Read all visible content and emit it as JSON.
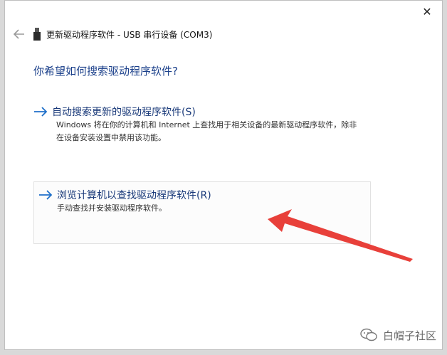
{
  "dialog": {
    "title": "更新驱动程序软件 - USB 串行设备 (COM3)",
    "close_glyph": "✕",
    "question": "你希望如何搜索驱动程序软件?",
    "options": [
      {
        "title": "自动搜索更新的驱动程序软件(S)",
        "description": "Windows 将在你的计算机和 Internet 上查找用于相关设备的最新驱动程序软件，除非在设备安装设置中禁用该功能。"
      },
      {
        "title": "浏览计算机以查找驱动程序软件(R)",
        "description": "手动查找并安装驱动程序软件。"
      }
    ]
  },
  "annotation": {
    "arrow_color": "#e8403a"
  },
  "watermark": {
    "text": "白帽子社区"
  },
  "colors": {
    "link": "#1a3a7a",
    "question": "#1a3f8a",
    "accent_arrow": "#1e6fc9"
  },
  "icons": {
    "back": "back-arrow-icon",
    "device": "usb-device-icon",
    "option_arrow": "right-arrow-icon",
    "close": "close-icon",
    "watermark": "wechat-icon"
  }
}
